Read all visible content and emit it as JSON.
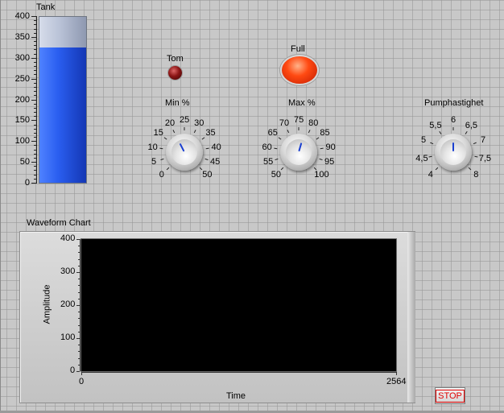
{
  "tank": {
    "label": "Tank",
    "scale": [
      "0",
      "50",
      "100",
      "150",
      "200",
      "250",
      "300",
      "350",
      "400"
    ],
    "range": [
      0,
      400
    ],
    "value": 327
  },
  "leds": {
    "tom_label": "Tom",
    "full_label": "Full",
    "tom_color": "#8b1515",
    "full_color": "#ff3a0a"
  },
  "knobs": {
    "min": {
      "label": "Min %",
      "ticks": [
        "0",
        "5",
        "10",
        "15",
        "20",
        "25",
        "30",
        "35",
        "40",
        "45",
        "50"
      ],
      "range": [
        0,
        50
      ],
      "value": 20
    },
    "max": {
      "label": "Max %",
      "ticks": [
        "50",
        "55",
        "60",
        "65",
        "70",
        "75",
        "80",
        "85",
        "90",
        "95",
        "100"
      ],
      "range": [
        50,
        100
      ],
      "value": 78
    },
    "pump": {
      "label": "Pumphastighet",
      "ticks": [
        "4",
        "4,5",
        "5",
        "5,5",
        "6",
        "6,5",
        "7",
        "7,5",
        "8"
      ],
      "range": [
        4,
        8
      ],
      "value": 6
    }
  },
  "waveform_chart": {
    "label": "Waveform Chart",
    "x_axis_label": "Time",
    "y_axis_label": "Amplitude",
    "x_ticks": [
      "0",
      "2564"
    ],
    "y_ticks": [
      "0",
      "100",
      "200",
      "300",
      "400"
    ],
    "x_range": [
      0,
      2564
    ],
    "y_range": [
      0,
      400
    ],
    "plot_background": "#000000"
  },
  "stop_button": {
    "label": "STOP",
    "text_color": "#e00000"
  }
}
